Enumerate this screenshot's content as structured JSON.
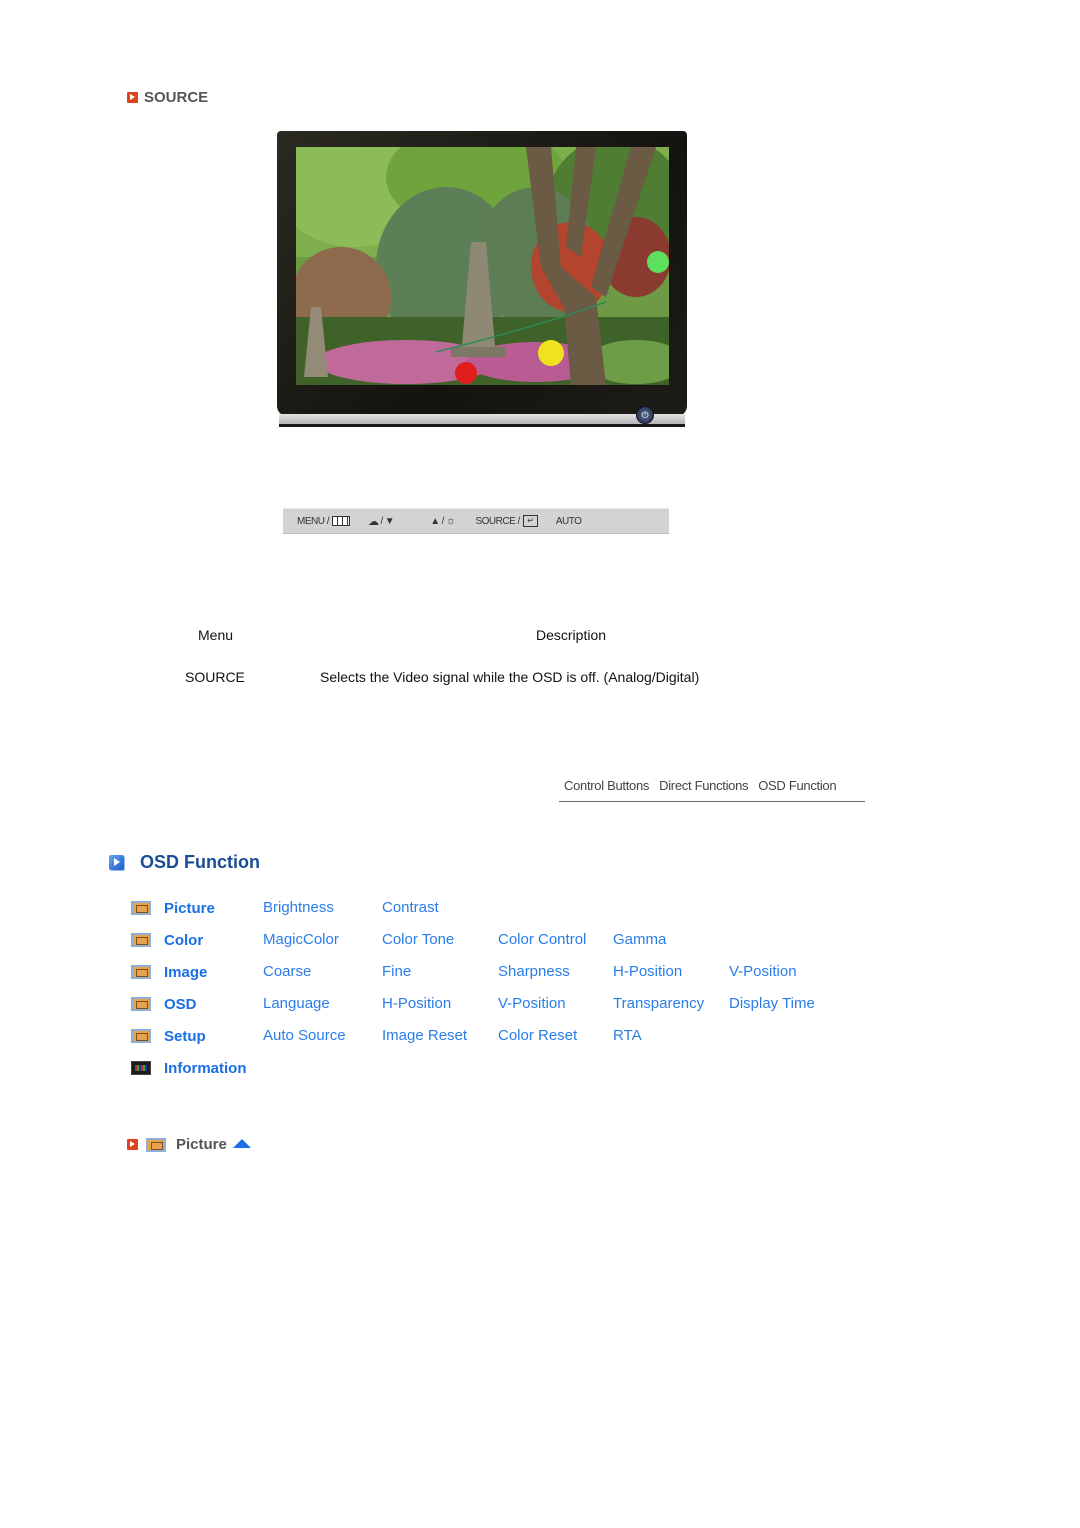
{
  "section": {
    "title": "SOURCE",
    "icon": "orange-play-icon"
  },
  "monitor_image": {
    "alt": "Monitor displaying a garden scene with a stone pagoda, trees and lanterns",
    "power_button_icon": "power-icon"
  },
  "control_bar": {
    "items": [
      {
        "label": "MENU /",
        "icon": "menu-grid-icon"
      },
      {
        "label": "/",
        "icon_left": "magicbright-icon",
        "icon_right": "down-arrow-icon"
      },
      {
        "label": "/",
        "icon_left": "up-arrow-icon",
        "icon_right": "brightness-icon"
      },
      {
        "label": "SOURCE /",
        "icon": "enter-icon"
      },
      {
        "label": "AUTO"
      }
    ]
  },
  "table": {
    "headers": {
      "menu": "Menu",
      "description": "Description"
    },
    "rows": [
      {
        "menu": "SOURCE",
        "description": "Selects the Video signal while the OSD is off. (Analog/Digital)"
      }
    ]
  },
  "nav_links": [
    "Control Buttons",
    "Direct Functions",
    "OSD Function"
  ],
  "osd": {
    "title": "OSD Function",
    "icon": "blue-play-icon",
    "categories": [
      {
        "label": "Picture",
        "icon": "picture-icon",
        "items": [
          "Brightness",
          "Contrast"
        ]
      },
      {
        "label": "Color",
        "icon": "color-icon",
        "items": [
          "MagicColor",
          "Color Tone",
          "Color Control",
          "Gamma"
        ]
      },
      {
        "label": "Image",
        "icon": "image-icon",
        "items": [
          "Coarse",
          "Fine",
          "Sharpness",
          "H-Position",
          "V-Position"
        ]
      },
      {
        "label": "OSD",
        "icon": "osd-icon",
        "items": [
          "Language",
          "H-Position",
          "V-Position",
          "Transparency",
          "Display Time"
        ]
      },
      {
        "label": "Setup",
        "icon": "setup-icon",
        "items": [
          "Auto Source",
          "Image Reset",
          "Color Reset",
          "RTA"
        ]
      },
      {
        "label": "Information",
        "icon": "information-icon",
        "items": []
      }
    ]
  },
  "footer_link": {
    "label": "Picture",
    "icon": "picture-icon",
    "up_icon": "up-arrow-icon"
  }
}
